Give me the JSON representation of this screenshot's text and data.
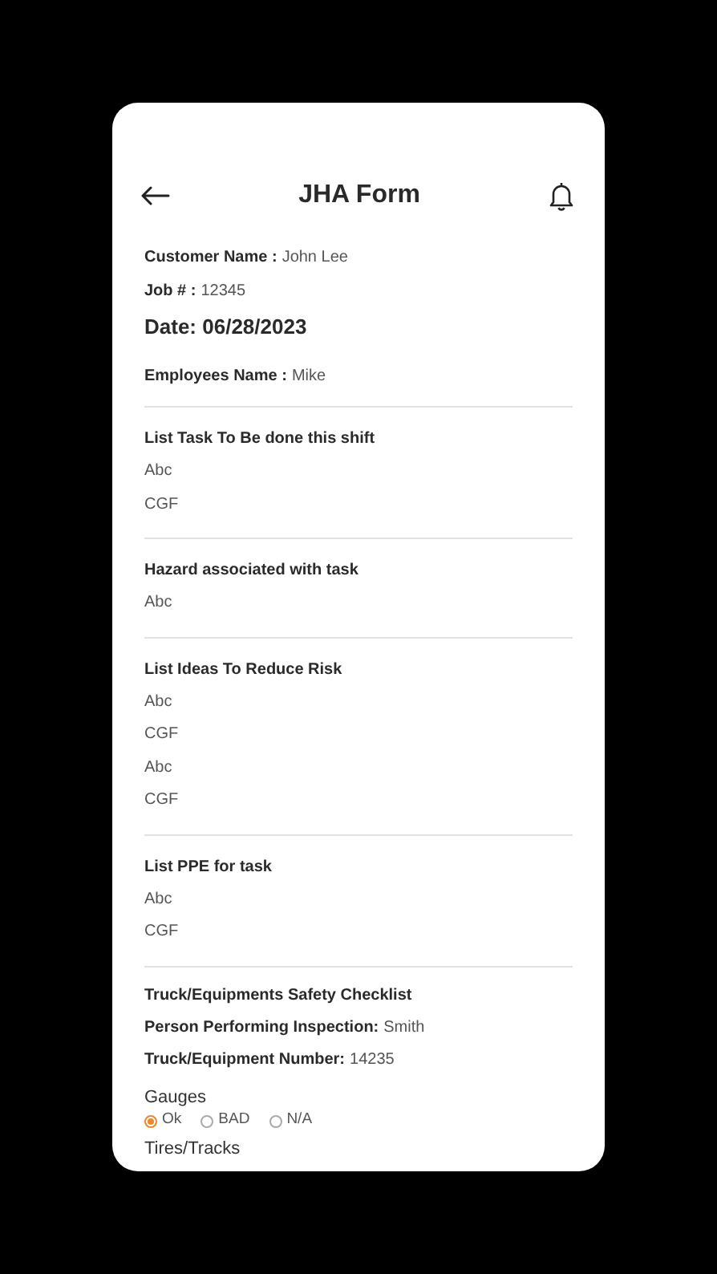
{
  "header": {
    "title": "JHA Form"
  },
  "info_fields": [
    {
      "label": "Customer Name :",
      "value": "John Lee"
    },
    {
      "label": "Job # :",
      "value": "12345"
    }
  ],
  "date": "Date: 06/28/2023",
  "employee": {
    "label": "Employees Name :",
    "value": "Mike"
  },
  "sections": [
    {
      "title": "List Task To Be done this shift",
      "items": [
        "Abc",
        "CGF"
      ]
    },
    {
      "title": "Hazard associated with task",
      "items": [
        "Abc"
      ]
    },
    {
      "title": "List Ideas To Reduce Risk",
      "items": [
        "Abc",
        "CGF",
        "Abc",
        "CGF"
      ]
    },
    {
      "title": "List PPE for task",
      "items": [
        "Abc",
        "CGF"
      ]
    }
  ],
  "checklist": {
    "title": "Truck/Equipments Safety Checklist",
    "fields": [
      {
        "label": "Person Performing Inspection:",
        "value": "Smith"
      },
      {
        "label": "Truck/Equipment Number:",
        "value": "14235"
      }
    ],
    "items": [
      {
        "label": "Gauges",
        "options": [
          {
            "label": "Ok",
            "selected": true
          },
          {
            "label": "BAD",
            "selected": false
          },
          {
            "label": "N/A",
            "selected": false
          }
        ]
      },
      {
        "label": "Tires/Tracks"
      }
    ]
  }
}
